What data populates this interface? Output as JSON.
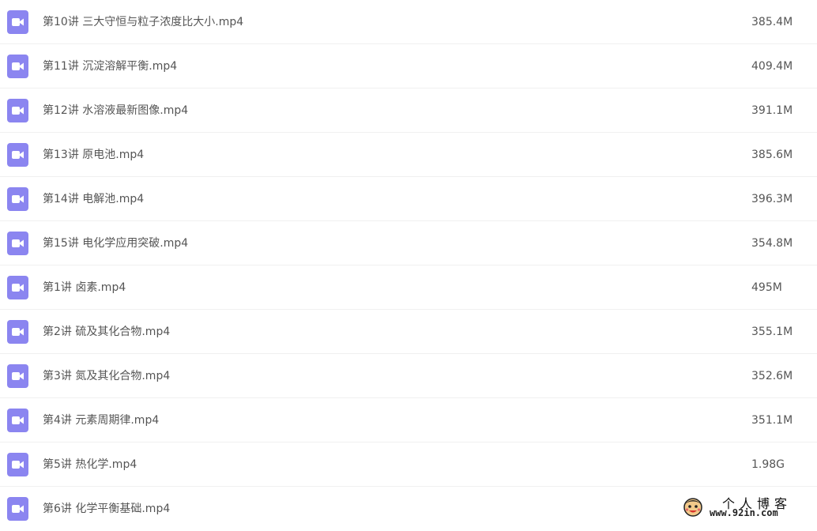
{
  "colors": {
    "icon_bg": "#8b85f0",
    "icon_fg": "#ffffff",
    "text": "#555555",
    "row_divider": "#f0f0f0"
  },
  "files": [
    {
      "name": "第10讲 三大守恒与粒子浓度比大小.mp4",
      "size": "385.4M",
      "icon": "video-file-icon"
    },
    {
      "name": "第11讲 沉淀溶解平衡.mp4",
      "size": "409.4M",
      "icon": "video-file-icon"
    },
    {
      "name": "第12讲 水溶液最新图像.mp4",
      "size": "391.1M",
      "icon": "video-file-icon"
    },
    {
      "name": "第13讲 原电池.mp4",
      "size": "385.6M",
      "icon": "video-file-icon"
    },
    {
      "name": "第14讲 电解池.mp4",
      "size": "396.3M",
      "icon": "video-file-icon"
    },
    {
      "name": "第15讲 电化学应用突破.mp4",
      "size": "354.8M",
      "icon": "video-file-icon"
    },
    {
      "name": "第1讲 卤素.mp4",
      "size": "495M",
      "icon": "video-file-icon"
    },
    {
      "name": "第2讲 硫及其化合物.mp4",
      "size": "355.1M",
      "icon": "video-file-icon"
    },
    {
      "name": "第3讲 氮及其化合物.mp4",
      "size": "352.6M",
      "icon": "video-file-icon"
    },
    {
      "name": "第4讲 元素周期律.mp4",
      "size": "351.1M",
      "icon": "video-file-icon"
    },
    {
      "name": "第5讲 热化学.mp4",
      "size": "1.98G",
      "icon": "video-file-icon"
    },
    {
      "name": "第6讲 化学平衡基础.mp4",
      "size": "",
      "icon": "video-file-icon"
    }
  ],
  "watermark": {
    "title": "个人博客",
    "url": "www.92in.com",
    "logo": "cartoon-face-logo"
  }
}
